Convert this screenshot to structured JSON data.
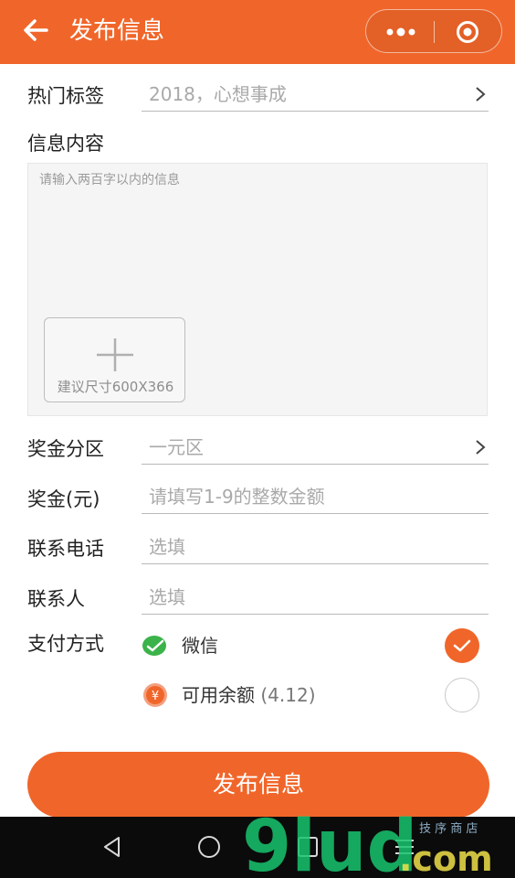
{
  "header": {
    "title": "发布信息",
    "bg_color": "#f0662a",
    "icons": [
      "back-arrow-icon",
      "more-dots-icon",
      "close-target-icon"
    ]
  },
  "form": {
    "hot_tags": {
      "label": "热门标签",
      "value": "2018，心想事成"
    },
    "content": {
      "label": "信息内容",
      "placeholder": "请输入两百字以内的信息",
      "upload_hint": "建议尺寸600X366"
    },
    "prize_zone": {
      "label": "奖金分区",
      "value": "一元区"
    },
    "prize_amount": {
      "label": "奖金(元)",
      "placeholder": "请填写1-9的整数金额"
    },
    "phone": {
      "label": "联系电话",
      "placeholder": "选填"
    },
    "contact": {
      "label": "联系人",
      "placeholder": "选填"
    },
    "payment": {
      "label": "支付方式",
      "options": [
        {
          "name": "微信",
          "extra": "",
          "selected": true,
          "icon": "wechat-pay-icon"
        },
        {
          "name": "可用余额",
          "extra": "(4.12)",
          "selected": false,
          "icon": "balance-yuan-icon"
        }
      ]
    }
  },
  "submit": {
    "label": "发布信息"
  },
  "watermark": {
    "text": "91ud.com",
    "note": "技 序 商 店"
  },
  "colors": {
    "accent": "#f0662a",
    "wechat": "#3bb34a",
    "navbar": "#0b0b0b"
  }
}
